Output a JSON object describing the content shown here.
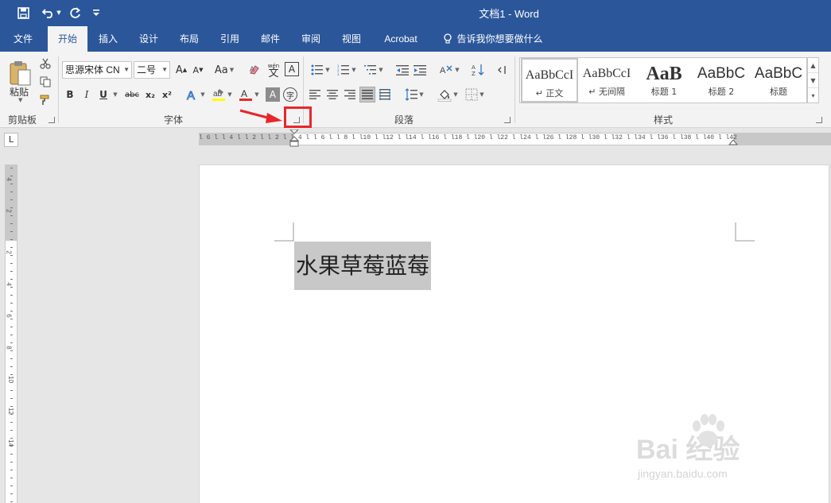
{
  "window": {
    "title": "文档1  -  Word"
  },
  "tabs": [
    {
      "label": "文件"
    },
    {
      "label": "开始"
    },
    {
      "label": "插入"
    },
    {
      "label": "设计"
    },
    {
      "label": "布局"
    },
    {
      "label": "引用"
    },
    {
      "label": "邮件"
    },
    {
      "label": "审阅"
    },
    {
      "label": "视图"
    },
    {
      "label": "Acrobat"
    },
    {
      "label": "告诉我你想要做什么"
    }
  ],
  "ribbon": {
    "clipboard": {
      "paste_label": "粘贴",
      "group_label": "剪贴板"
    },
    "font": {
      "font_name": "思源宋体 CN",
      "font_size": "二号",
      "group_label": "字体",
      "bold": "B",
      "italic": "I",
      "underline": "U",
      "strike": "abc",
      "subscript": "x₂",
      "superscript": "x²",
      "change_case": "Aa",
      "grow": "A",
      "shrink": "A",
      "pinyin": "wén",
      "pinyin_char": "文",
      "char_border": "A",
      "char_shading": "A",
      "enclose": "字"
    },
    "paragraph": {
      "group_label": "段落"
    },
    "styles": {
      "group_label": "样式",
      "items": [
        {
          "sample": "AaBbCcI",
          "name": "↵ 正文"
        },
        {
          "sample": "AaBbCcI",
          "name": "↵ 无间隔"
        },
        {
          "sample": "AaB",
          "name": "标题 1"
        },
        {
          "sample": "AaBbC",
          "name": "标题 2"
        },
        {
          "sample": "AaBbC",
          "name": "标题"
        }
      ]
    }
  },
  "ruler": {
    "horizontal_text": "l 6 l  l 4 l  l 2 l     l 2 l  l 4 l  l 6 l  l 8 l  l10 l  l12 l  l14 l  l16 l  l18 l  l20 l  l22 l  l24 l  l26 l  l28 l  l30 l  l32 l  l34 l  l36 l  l38 l  l40 l  l42",
    "vertical_labels": [
      "4",
      "2",
      "2",
      "4",
      "6",
      "8",
      "10",
      "12",
      "14"
    ],
    "tab_selector": "L"
  },
  "document": {
    "text": "水果草莓蓝莓"
  },
  "watermark": {
    "main": "Bai 经验",
    "sub": "jingyan.baidu.com"
  },
  "colors": {
    "titlebar": "#2b579a",
    "ribbon": "#f3f3f3",
    "highlight": "#e8262b",
    "selection": "#c8c8c8"
  }
}
